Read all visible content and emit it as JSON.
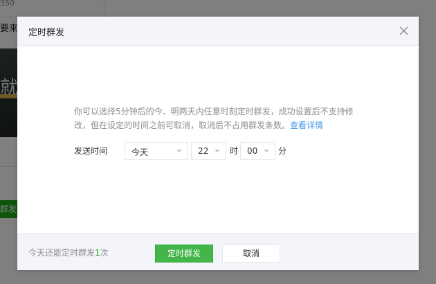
{
  "background": {
    "topbar_text": "350",
    "snippet_text": "要来",
    "thumb_char": "就",
    "green_button_label": "群发"
  },
  "dialog": {
    "title": "定时群发",
    "close_icon": "close-icon",
    "description": "你可以选择5分钟后的今、明两天内任意时刻定时群发，成功设置后不支持修改，但在设定的时间之前可取消，取消后不占用群发条数。",
    "detail_link": "查看详情",
    "send_time_label": "发送时间",
    "day_select": {
      "value": "今天"
    },
    "hour_select": {
      "value": "22"
    },
    "hour_unit": "时",
    "minute_select": {
      "value": "00"
    },
    "minute_unit": "分",
    "footer": {
      "quota_prefix": "今天还能定时群发",
      "quota_count": "1",
      "quota_suffix": "次",
      "confirm_label": "定时群发",
      "cancel_label": "取消"
    }
  },
  "colors": {
    "primary_green": "#44b549",
    "link_blue": "#459ae9",
    "overlay": "rgba(0,0,0,0.5)"
  }
}
